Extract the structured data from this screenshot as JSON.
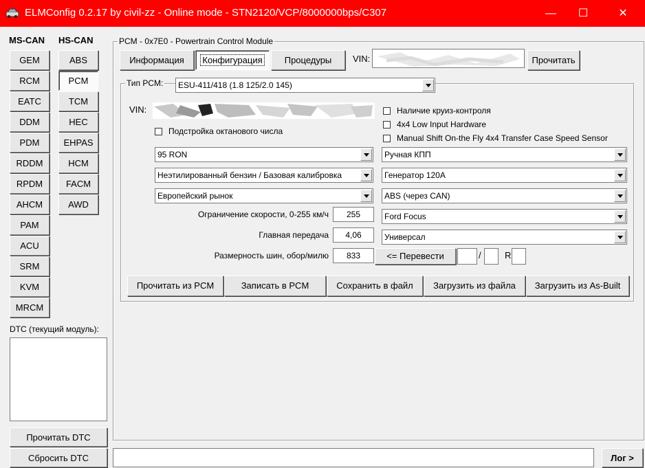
{
  "window": {
    "title": "ELMConfig 0.2.17 by civil-zz - Online mode - STN2120/VCP/8000000bps/C307",
    "minimize": "—",
    "maximize": "☐",
    "close": "✕"
  },
  "modules": {
    "ms_header": "MS-CAN",
    "hs_header": "HS-CAN",
    "ms": [
      "GEM",
      "RCM",
      "EATC",
      "DDM",
      "PDM",
      "RDDM",
      "RPDM",
      "AHCM",
      "PAM",
      "ACU",
      "SRM",
      "KVM",
      "MRCM"
    ],
    "hs": [
      "ABS",
      "PCM",
      "TCM",
      "HEC",
      "EHPAS",
      "HCM",
      "FACM",
      "AWD"
    ],
    "selected_hs": "PCM"
  },
  "dtc": {
    "label": "DTC (текущий модуль):",
    "read": "Прочитать DTC",
    "reset": "Сбросить DTC"
  },
  "module_panel": {
    "title": "PCM - 0x7E0 - Powertrain Control Module",
    "tabs": [
      "Информация",
      "Конфигурация",
      "Процедуры"
    ],
    "active_tab": "Конфигурация",
    "vin_label": "VIN:",
    "read_button": "Прочитать"
  },
  "config": {
    "type_label": "Тип PCM:",
    "type_value": "ESU-411/418 (1.8 125/2.0 145)",
    "vin_label": "VIN:",
    "checks": {
      "octane": "Подстройка октанового числа",
      "cruise": "Наличие круиз-контроля",
      "low_input": "4x4 Low Input Hardware",
      "manual_shift": "Manual Shift On-the Fly 4x4 Transfer Case Speed Sensor"
    },
    "left_combos": [
      "95 RON",
      "Неэтилированный бензин / Базовая калибровка",
      "Европейский рынок"
    ],
    "right_combos": [
      "Ручная КПП",
      "Генератор 120A",
      "ABS (через CAN)",
      "Ford Focus",
      "Универсал"
    ],
    "speed_limit_label": "Ограничение скорости, 0-255 км/ч",
    "speed_limit_value": "255",
    "final_drive_label": "Главная передача",
    "final_drive_value": "4,06",
    "tire_label": "Размерность шин, обор/милю",
    "tire_value": "833",
    "convert_button": "<= Перевести",
    "slash": "/",
    "r_label": "R",
    "actions": [
      "Прочитать из PCM",
      "Записать в PCM",
      "Сохранить в файл",
      "Загрузить из файла",
      "Загрузить из As-Built"
    ]
  },
  "status": {
    "log_button": "Лог >"
  }
}
